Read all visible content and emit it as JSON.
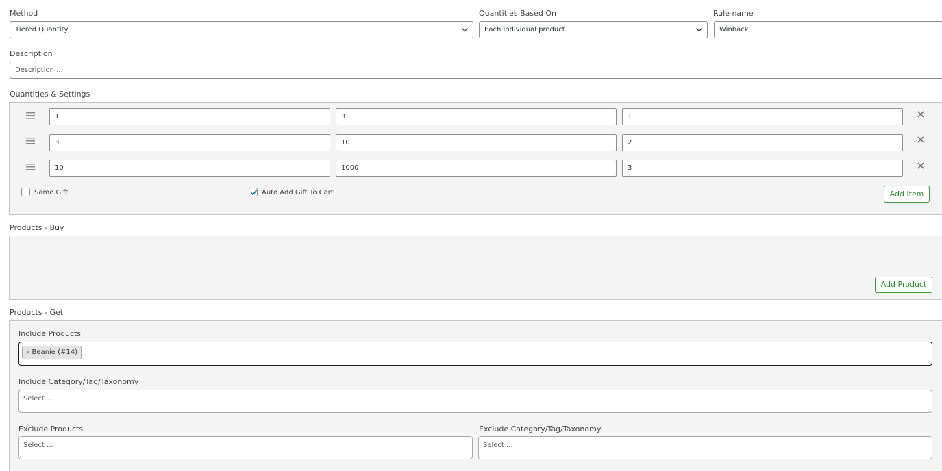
{
  "method": {
    "label": "Method",
    "value": "Tiered Quantity"
  },
  "quantities_based_on": {
    "label": "Quantities Based On",
    "value": "Each individual product"
  },
  "rule_name": {
    "label": "Rule name",
    "value": "Winback"
  },
  "description": {
    "label": "Description",
    "placeholder": "Description ..."
  },
  "quantities_settings": {
    "label": "Quantities & Settings",
    "rows": [
      {
        "min": "1",
        "max": "3",
        "gift_qty": "1"
      },
      {
        "min": "3",
        "max": "10",
        "gift_qty": "2"
      },
      {
        "min": "10",
        "max": "1000",
        "gift_qty": "3"
      }
    ],
    "same_gift": {
      "label": "Same Gift",
      "checked": false
    },
    "auto_add": {
      "label": "Auto Add Gift To Cart",
      "checked": true
    },
    "add_item_label": "Add item"
  },
  "products_buy": {
    "label": "Products - Buy",
    "add_product_label": "Add Product"
  },
  "products_get": {
    "label": "Products - Get",
    "include_products": {
      "label": "Include Products",
      "tags": [
        {
          "remove": "×",
          "text": "Beanie (#14)"
        }
      ]
    },
    "include_category": {
      "label": "Include Category/Tag/Taxonomy",
      "placeholder": "Select ..."
    },
    "exclude_products": {
      "label": "Exclude Products",
      "placeholder": "Select ..."
    },
    "exclude_category": {
      "label": "Exclude Category/Tag/Taxonomy",
      "placeholder": "Select ..."
    }
  },
  "colors": {
    "accent_green": "#2e8b2e",
    "panel_bg": "#f4f4f4",
    "border": "#8c8f94"
  },
  "icons": [
    "chevron-down-icon",
    "drag-handle-icon",
    "close-icon",
    "checkmark-icon"
  ]
}
